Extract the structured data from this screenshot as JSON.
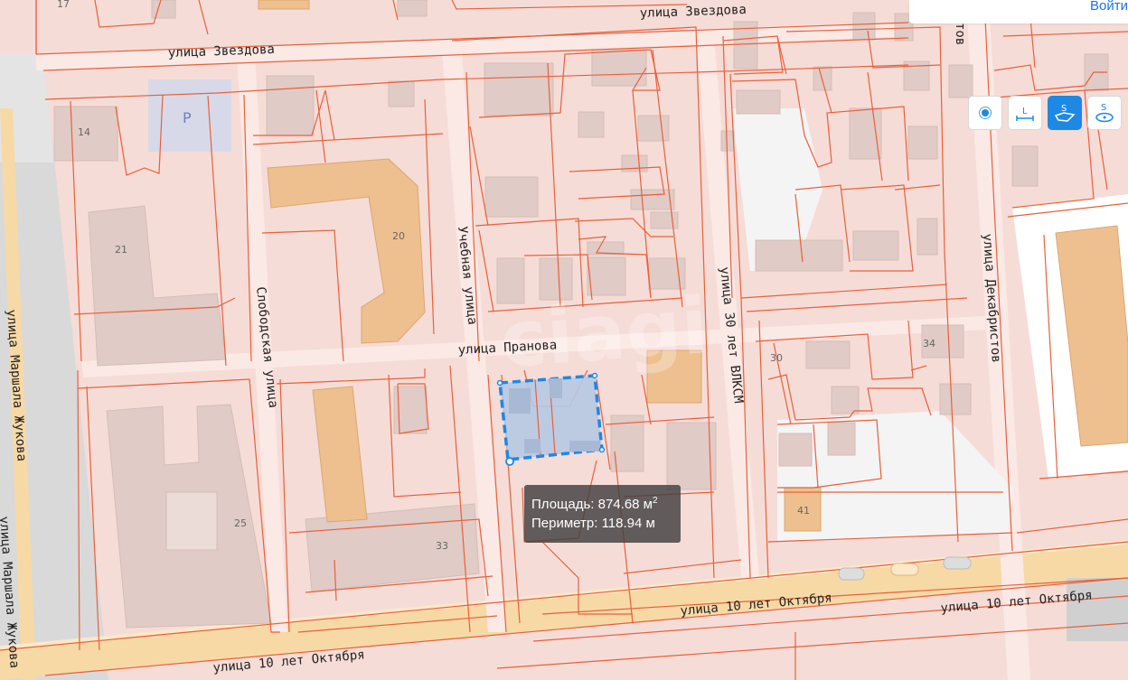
{
  "header": {
    "login_label": "Войти"
  },
  "tools": [
    {
      "icon": "point-measure-icon",
      "label": "",
      "active": false
    },
    {
      "icon": "length-measure-icon",
      "label": "L",
      "active": false
    },
    {
      "icon": "area-measure-icon",
      "label": "S",
      "active": true
    },
    {
      "icon": "circle-area-measure-icon",
      "label": "S",
      "active": false
    }
  ],
  "measurement": {
    "area_label": "Площадь:",
    "area_value": "874.68 м",
    "area_unit_exp": "2",
    "perimeter_label": "Периметр:",
    "perimeter_value": "118.94 м"
  },
  "streets": {
    "zvezdova_1": "улица Звездова",
    "zvezdova_2": "улица Звездова",
    "uchebnaya": "Учебная улица",
    "slobodskaya": "Слободская улица",
    "pranova": "улица Пранова",
    "vlksm": "улица 30 лет ВЛКСМ",
    "dekabristov": "улица Декабристов",
    "zhukova_1": "улица Маршала Жукова",
    "zhukova_2": "улица Маршала Жукова",
    "oktyabrya_1": "улица 10 лет Октября",
    "oktyabrya_2": "улица 10 лет Октября",
    "oktyabrya_3": "улица 10 лет Октября",
    "tov_fragment": "тов"
  },
  "house_numbers": [
    "17",
    "14",
    "21",
    "20",
    "25",
    "33",
    "30",
    "34",
    "41"
  ],
  "parking_label": "P",
  "colors": {
    "background": "#f6dcd6",
    "parcel_line": "#e8603c",
    "building": "#e0cbc6",
    "building_highlight": "#eec08f",
    "selection_fill": "#b7c9e3",
    "selection_stroke": "#1e88e5",
    "main_road": "#f7d9a6"
  }
}
